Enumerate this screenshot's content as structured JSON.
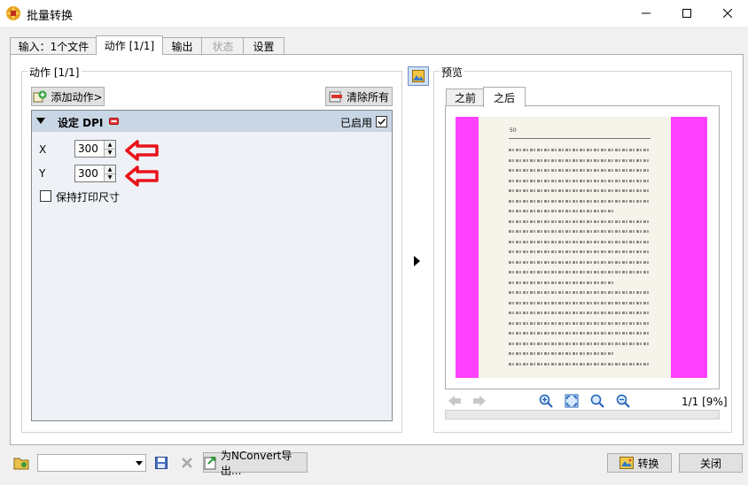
{
  "window": {
    "title": "批量转换"
  },
  "tabs": [
    {
      "label": "输入：1个文件"
    },
    {
      "label": "动作 [1/1]"
    },
    {
      "label": "输出"
    },
    {
      "label": "状态"
    },
    {
      "label": "设置"
    }
  ],
  "actions": {
    "group_title": "动作 [1/1]",
    "add_label": "添加动作>",
    "clear_label": "清除所有",
    "item": {
      "title": "设定 DPI",
      "enabled_label": "已启用",
      "x_label": "X",
      "x_value": "300",
      "y_label": "Y",
      "y_value": "300",
      "keep_label": "保持打印尺寸"
    }
  },
  "preview": {
    "group_title": "预览",
    "tab_before": "之前",
    "tab_after": "之后",
    "page_counter": "1/1 [9%]",
    "page_number": "50"
  },
  "bottom": {
    "export_label": "为NConvert导出...",
    "convert_label": "转换",
    "close_label": "关闭"
  },
  "colors": {
    "accent_magenta": "#ff40ff",
    "arrow_red": "#e8141b"
  }
}
